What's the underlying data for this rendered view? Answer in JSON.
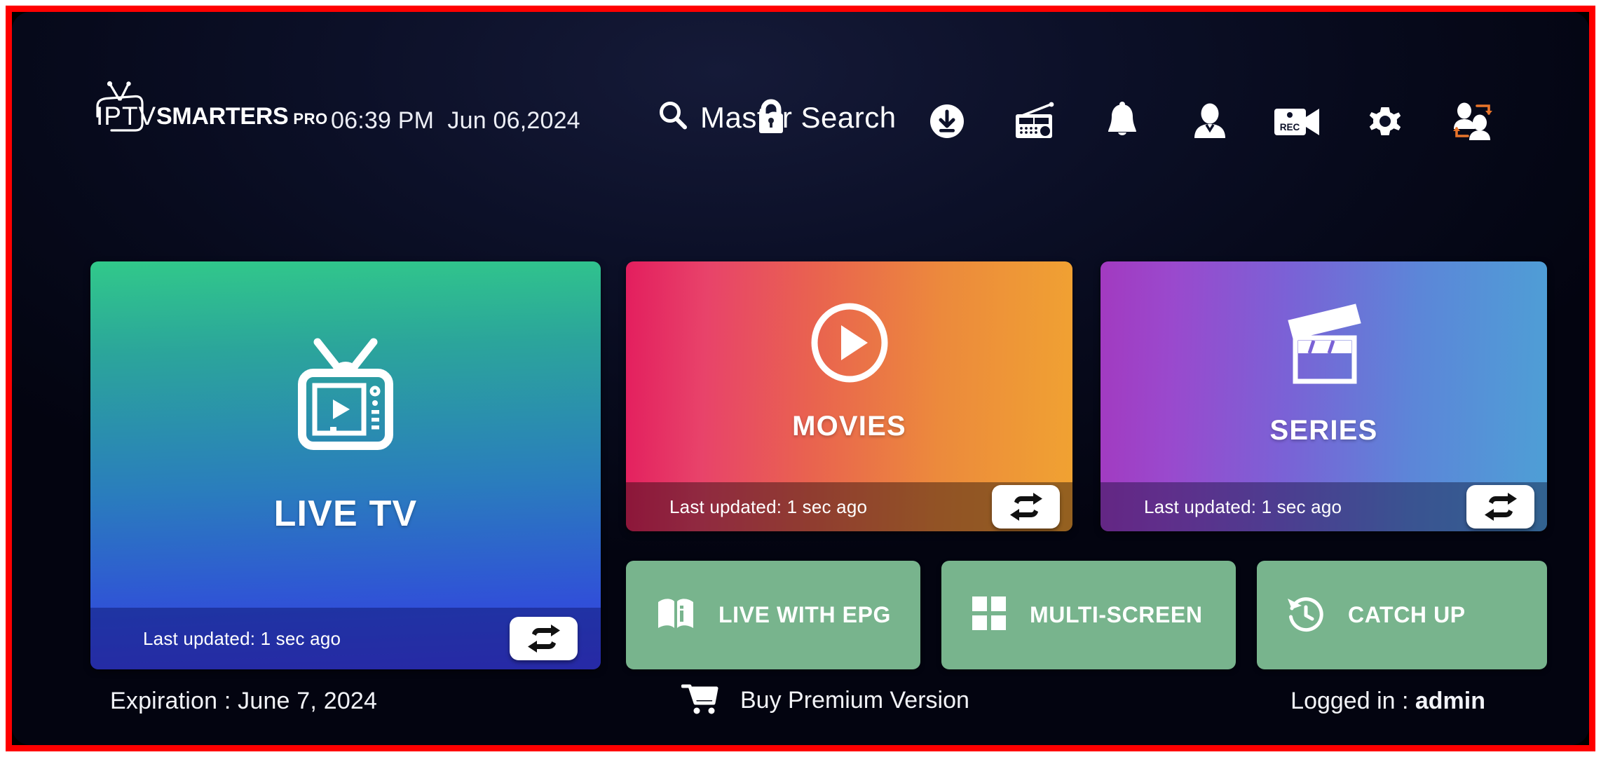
{
  "app": {
    "logo_iptv": "IPTV",
    "logo_smarters": "SMARTERS",
    "logo_pro": "PRO"
  },
  "header": {
    "datetime": "06:39 PM  Jun 06,2024",
    "master_search_label": "Master Search",
    "icons": [
      {
        "name": "download-icon",
        "label": "Download"
      },
      {
        "name": "radio-icon",
        "label": "Radio"
      },
      {
        "name": "bell-icon",
        "label": "Notifications"
      },
      {
        "name": "account-icon",
        "label": "Account"
      },
      {
        "name": "rec-camera-icon",
        "label": "REC"
      },
      {
        "name": "gear-icon",
        "label": "Settings"
      },
      {
        "name": "switch-user-icon",
        "label": "Switch User"
      }
    ],
    "rec_badge_text": "REC"
  },
  "cards": [
    {
      "id": "live-tv",
      "title": "LIVE TV",
      "updated": "Last updated: 1 sec ago",
      "icon": "tv-play-icon",
      "gradient_from": "#31c98a",
      "gradient_to": "#3d3fdc"
    },
    {
      "id": "movies",
      "title": "MOVIES",
      "updated": "Last updated: 1 sec ago",
      "icon": "play-circle-icon",
      "gradient_from": "#e31e5e",
      "gradient_to": "#f0a232"
    },
    {
      "id": "series",
      "title": "SERIES",
      "updated": "Last updated: 1 sec ago",
      "icon": "clapperboard-icon",
      "gradient_from": "#a23ac0",
      "gradient_to": "#4e9fd6"
    }
  ],
  "quick_buttons": [
    {
      "id": "live-with-epg",
      "label": "LIVE WITH EPG",
      "icon": "book-info-icon"
    },
    {
      "id": "multi-screen",
      "label": "MULTI-SCREEN",
      "icon": "grid-four-icon"
    },
    {
      "id": "catch-up",
      "label": "CATCH UP",
      "icon": "history-clock-icon"
    }
  ],
  "footer": {
    "expiration": "Expiration : June 7, 2024",
    "buy_premium": "Buy Premium Version",
    "logged_in_prefix": "Logged in : ",
    "logged_in_user": "admin"
  },
  "colors": {
    "border": "#ff0000",
    "background": "#070a1c",
    "quick_button": "#78b48d",
    "accent_orange": "#e8742a"
  }
}
